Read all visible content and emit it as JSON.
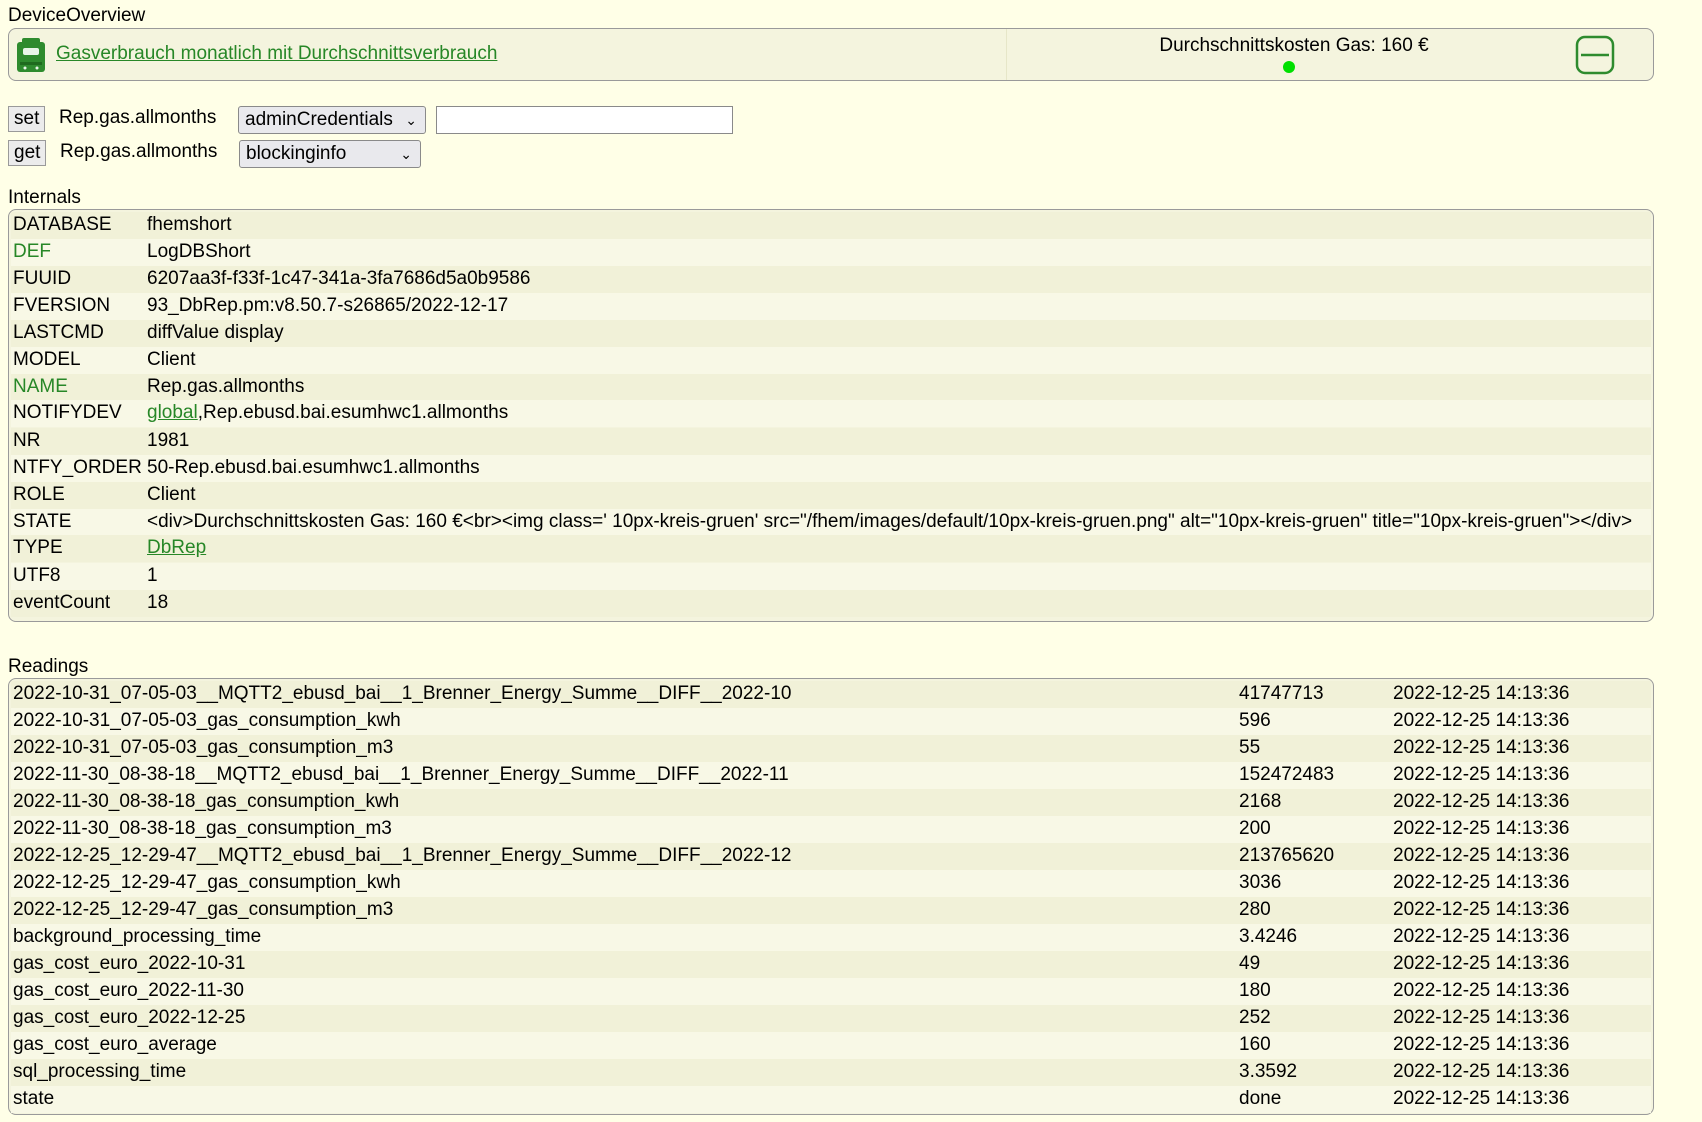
{
  "overview": {
    "section_title": "DeviceOverview",
    "device_link": "Gasverbrauch monatlich mit Durchschnittsverbrauch",
    "state_text": "Durchschnittskosten Gas: 160 €",
    "icon": "device-icon",
    "led_color": "#00E000",
    "toggle_icon": "toggle-icon"
  },
  "commands": {
    "set": {
      "button": "set",
      "device": "Rep.gas.allmonths",
      "selected": "adminCredentials",
      "input_value": ""
    },
    "get": {
      "button": "get",
      "device": "Rep.gas.allmonths",
      "selected": "blockinginfo"
    }
  },
  "internals": {
    "title": "Internals",
    "rows": [
      {
        "name": "DATABASE",
        "value": "fhemshort"
      },
      {
        "name": "DEF",
        "value": "LogDBShort"
      },
      {
        "name": "FUUID",
        "value": "6207aa3f-f33f-1c47-341a-3fa7686d5a0b9586"
      },
      {
        "name": "FVERSION",
        "value": "93_DbRep.pm:v8.50.7-s26865/2022-12-17"
      },
      {
        "name": "LASTCMD",
        "value": "diffValue display"
      },
      {
        "name": "MODEL",
        "value": "Client"
      },
      {
        "name": "NAME",
        "value": "Rep.gas.allmonths"
      },
      {
        "name": "NOTIFYDEV",
        "value_link": "global",
        "value_rest": ",Rep.ebusd.bai.esumhwc1.allmonths"
      },
      {
        "name": "NR",
        "value": "1981"
      },
      {
        "name": "NTFY_ORDER",
        "value": "50-Rep.ebusd.bai.esumhwc1.allmonths"
      },
      {
        "name": "ROLE",
        "value": "Client"
      },
      {
        "name": "STATE",
        "value": "<div>Durchschnittskosten Gas: 160 €<br><img class=' 10px-kreis-gruen' src=\"/fhem/images/default/10px-kreis-gruen.png\" alt=\"10px-kreis-gruen\" title=\"10px-kreis-gruen\"></div>"
      },
      {
        "name": "TYPE",
        "value_link": "DbRep",
        "value_rest": ""
      },
      {
        "name": "UTF8",
        "value": "1"
      },
      {
        "name": "eventCount",
        "value": "18"
      }
    ]
  },
  "readings": {
    "title": "Readings",
    "rows": [
      {
        "name": "2022-10-31_07-05-03__MQTT2_ebusd_bai__1_Brenner_Energy_Summe__DIFF__2022-10",
        "value": "41747713",
        "time": "2022-12-25 14:13:36"
      },
      {
        "name": "2022-10-31_07-05-03_gas_consumption_kwh",
        "value": "596",
        "time": "2022-12-25 14:13:36"
      },
      {
        "name": "2022-10-31_07-05-03_gas_consumption_m3",
        "value": "55",
        "time": "2022-12-25 14:13:36"
      },
      {
        "name": "2022-11-30_08-38-18__MQTT2_ebusd_bai__1_Brenner_Energy_Summe__DIFF__2022-11",
        "value": "152472483",
        "time": "2022-12-25 14:13:36"
      },
      {
        "name": "2022-11-30_08-38-18_gas_consumption_kwh",
        "value": "2168",
        "time": "2022-12-25 14:13:36"
      },
      {
        "name": "2022-11-30_08-38-18_gas_consumption_m3",
        "value": "200",
        "time": "2022-12-25 14:13:36"
      },
      {
        "name": "2022-12-25_12-29-47__MQTT2_ebusd_bai__1_Brenner_Energy_Summe__DIFF__2022-12",
        "value": "213765620",
        "time": "2022-12-25 14:13:36"
      },
      {
        "name": "2022-12-25_12-29-47_gas_consumption_kwh",
        "value": "3036",
        "time": "2022-12-25 14:13:36"
      },
      {
        "name": "2022-12-25_12-29-47_gas_consumption_m3",
        "value": "280",
        "time": "2022-12-25 14:13:36"
      },
      {
        "name": "background_processing_time",
        "value": "3.4246",
        "time": "2022-12-25 14:13:36"
      },
      {
        "name": "gas_cost_euro_2022-10-31",
        "value": "49",
        "time": "2022-12-25 14:13:36"
      },
      {
        "name": "gas_cost_euro_2022-11-30",
        "value": "180",
        "time": "2022-12-25 14:13:36"
      },
      {
        "name": "gas_cost_euro_2022-12-25",
        "value": "252",
        "time": "2022-12-25 14:13:36"
      },
      {
        "name": "gas_cost_euro_average",
        "value": "160",
        "time": "2022-12-25 14:13:36"
      },
      {
        "name": "sql_processing_time",
        "value": "3.3592",
        "time": "2022-12-25 14:13:36"
      },
      {
        "name": "state",
        "value": "done",
        "time": "2022-12-25 14:13:36"
      }
    ]
  },
  "colors": {
    "accent": "#278727",
    "background": "#FFFFE7",
    "row_odd": "#F1F1D8",
    "row_even": "#F8F8E6"
  }
}
